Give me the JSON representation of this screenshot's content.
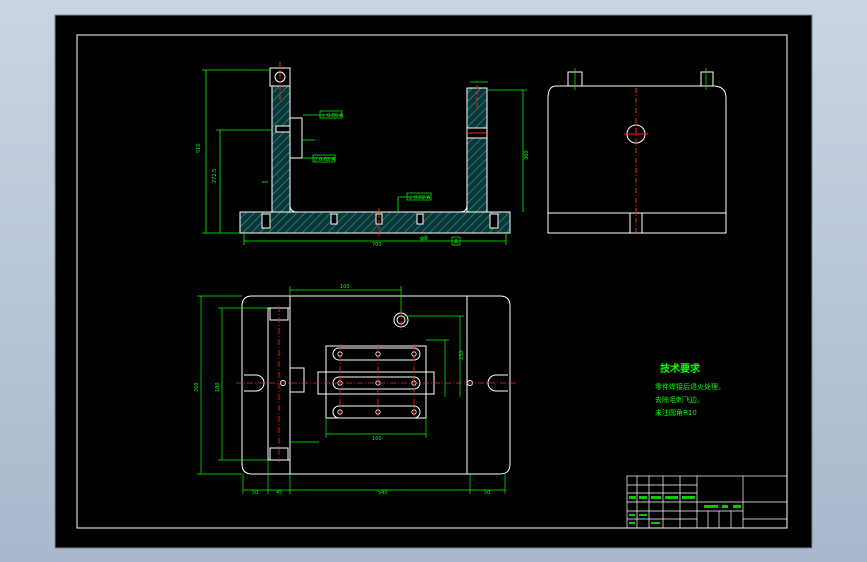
{
  "colors": {
    "viewport": "#000000",
    "frame": "#ffffff",
    "geometry": "#ffffff",
    "dimensions": "#00ff00",
    "centerline": "#ff0000",
    "hatch": "#00c8c8",
    "notes": "#00ff00"
  },
  "tech_req": {
    "title": "技术要求",
    "lines": [
      "零件焊接后退火处理。",
      "去除毛刺飞边。",
      "未注圆角R10"
    ]
  },
  "front_view": {
    "dims": {
      "width": "700",
      "height": "510",
      "height2": "272.5",
      "right_h": "360",
      "surface": "φ8"
    },
    "callouts": [
      "⊥ 0.05 A",
      "// 0.02 A",
      "⊥ 0.02 A"
    ],
    "datum": "A"
  },
  "top_view": {
    "dims": {
      "top_span": "100",
      "right_w": "230",
      "inner_w": "160",
      "left_h": "260",
      "row_gap": "180",
      "b1": "50",
      "b2": "45",
      "b3": "540",
      "b4": "50"
    }
  }
}
